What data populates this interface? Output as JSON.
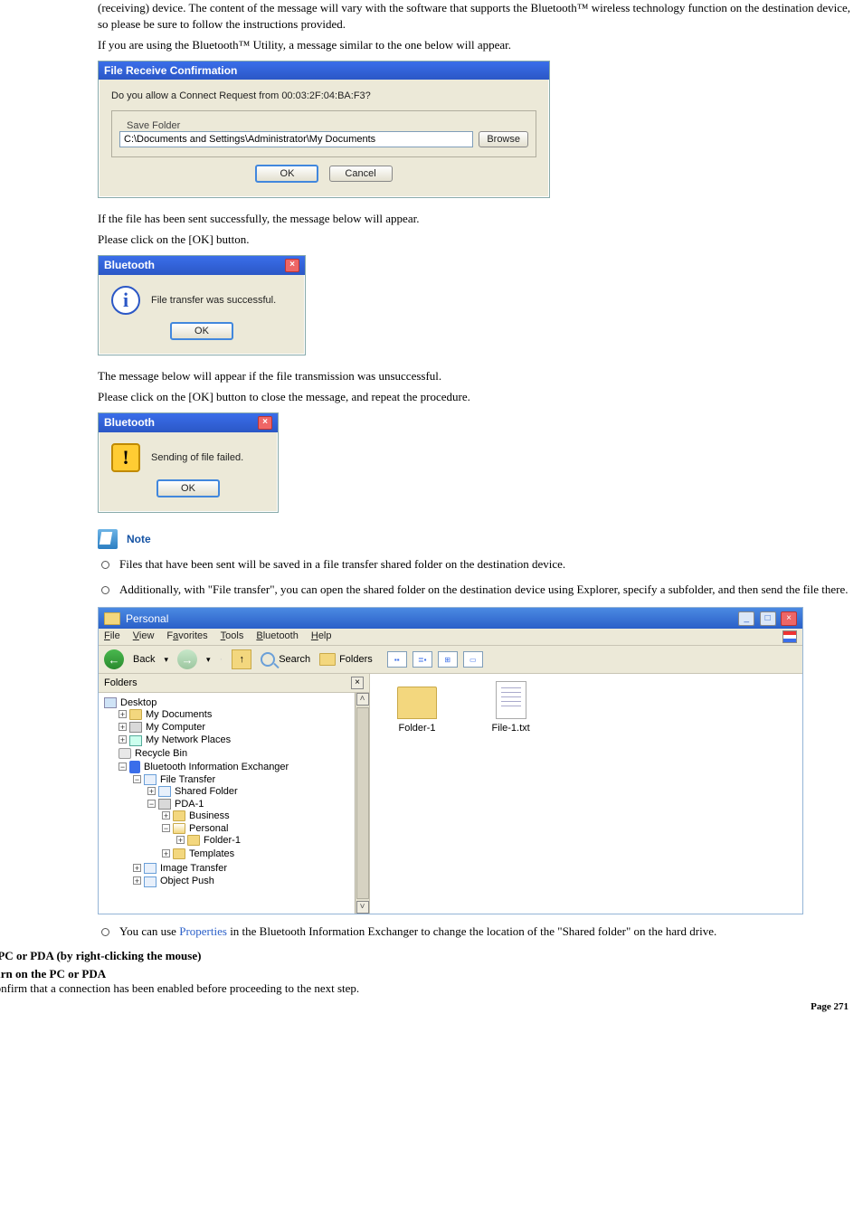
{
  "intro": {
    "p1": "(receiving) device. The content of the message will vary with the software that supports the Bluetooth™ wireless technology function on the destination device, so please be sure to follow the instructions provided.",
    "p2": "If you are using the Bluetooth™ Utility, a message similar to the one below will appear."
  },
  "dialog1": {
    "title": "File Receive Confirmation",
    "question": "Do you allow a Connect Request from 00:03:2F:04:BA:F3?",
    "frame_label": "Save Folder",
    "path_value": "C:\\Documents and Settings\\Administrator\\My Documents",
    "browse": "Browse",
    "ok": "OK",
    "cancel": "Cancel"
  },
  "mid": {
    "p1": "If the file has been sent successfully, the message below will appear.",
    "p2": "Please click on the [OK] button."
  },
  "dialog2": {
    "title": "Bluetooth",
    "msg": "File transfer was successful.",
    "ok": "OK"
  },
  "mid2": {
    "p1": "The message below will appear if the file transmission was unsuccessful.",
    "p2": "Please click on the [OK] button to close the message, and repeat the procedure."
  },
  "dialog3": {
    "title": "Bluetooth",
    "msg": "Sending of file failed.",
    "ok": "OK"
  },
  "note": {
    "title": "Note",
    "items": [
      "Files that have been sent will be saved in a file transfer shared folder on the destination device.",
      "Additionally, with \"File transfer\", you can open the shared folder on the destination device using Explorer, specify a subfolder, and then send the file there."
    ]
  },
  "explorer": {
    "title": "Personal",
    "menus": [
      "File",
      "View",
      "Favorites",
      "Tools",
      "Bluetooth",
      "Help"
    ],
    "menus_u": [
      "F",
      "V",
      "a",
      "T",
      "B",
      "H"
    ],
    "toolbar": {
      "back": "Back",
      "search": "Search",
      "folders": "Folders"
    },
    "sidebar_title": "Folders",
    "tree": {
      "desktop": "Desktop",
      "mydocs": "My Documents",
      "mycomp": "My Computer",
      "mynet": "My Network Places",
      "recycle": "Recycle Bin",
      "btex": "Bluetooth Information Exchanger",
      "ft": "File Transfer",
      "shared": "Shared Folder",
      "pda": "PDA-1",
      "business": "Business",
      "personal": "Personal",
      "folder1": "Folder-1",
      "templates": "Templates",
      "image": "Image Transfer",
      "obj": "Object Push"
    },
    "content": {
      "folder": "Folder-1",
      "file": "File-1.txt"
    }
  },
  "note2": {
    "item_pre": "You can use ",
    "item_link": "Properties",
    "item_post": " in the Bluetooth Information Exchanger to change the location of the \"Shared folder\" on the hard drive."
  },
  "section": {
    "title": "■Sending files to a PC or PDA (by right-clicking the mouse)",
    "step1_title": "Turn on the PC or PDA",
    "step1_body": "Confirm that a connection has been enabled before proceeding to the next step."
  },
  "footer": "Page 271"
}
